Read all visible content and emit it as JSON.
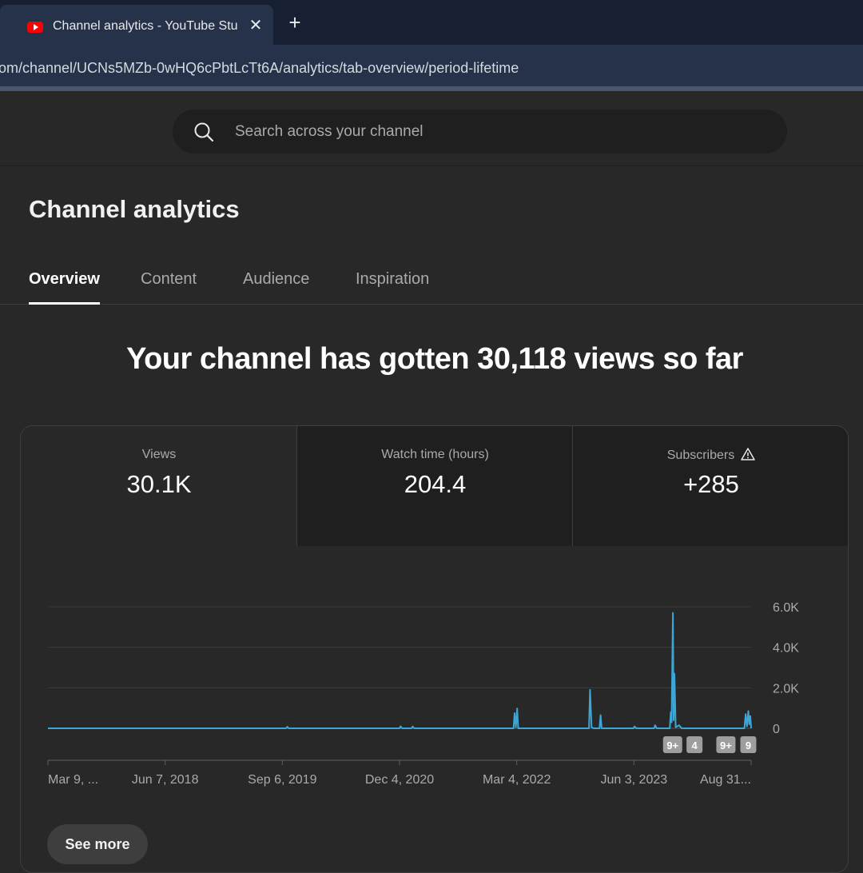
{
  "browser": {
    "tab_title": "Channel analytics - YouTube Studio",
    "close_glyph": "✕",
    "new_tab_glyph": "+",
    "url": "om/channel/UCNs5MZb-0wHQ6cPbtLcTt6A/analytics/tab-overview/period-lifetime"
  },
  "header": {
    "search_placeholder": "Search across your channel"
  },
  "page": {
    "title": "Channel analytics",
    "tabs": [
      {
        "label": "Overview",
        "active": true
      },
      {
        "label": "Content",
        "active": false
      },
      {
        "label": "Audience",
        "active": false
      },
      {
        "label": "Inspiration",
        "active": false
      }
    ],
    "headline": "Your channel has gotten 30,118 views so far"
  },
  "metrics": [
    {
      "label": "Views",
      "value": "30.1K",
      "selected": true
    },
    {
      "label": "Watch time (hours)",
      "value": "204.4",
      "selected": false
    },
    {
      "label": "Subscribers",
      "value": "+285",
      "selected": false,
      "icon": "warning-icon"
    }
  ],
  "see_more_label": "See more",
  "chart_data": {
    "type": "line",
    "color": "#3ea6d6",
    "y_ticks": [
      "6.0K",
      "4.0K",
      "2.0K",
      "0"
    ],
    "ylim": [
      0,
      6000
    ],
    "x_ticks": [
      "Mar 9, ...",
      "Jun 7, 2018",
      "Sep 6, 2019",
      "Dec 4, 2020",
      "Mar 4, 2022",
      "Jun 3, 2023",
      "Aug 31..."
    ],
    "x_range": [
      "2017-03-09",
      "2024-08-31"
    ],
    "points": [
      [
        "2017-03-09",
        0
      ],
      [
        "2019-09-20",
        0
      ],
      [
        "2019-09-25",
        80
      ],
      [
        "2019-09-30",
        0
      ],
      [
        "2020-12-04",
        0
      ],
      [
        "2020-12-08",
        100
      ],
      [
        "2020-12-14",
        0
      ],
      [
        "2021-01-20",
        0
      ],
      [
        "2021-01-24",
        90
      ],
      [
        "2021-01-30",
        0
      ],
      [
        "2022-02-20",
        0
      ],
      [
        "2022-02-24",
        750
      ],
      [
        "2022-03-01",
        50
      ],
      [
        "2022-03-06",
        980
      ],
      [
        "2022-03-10",
        0
      ],
      [
        "2022-12-10",
        0
      ],
      [
        "2022-12-14",
        1900
      ],
      [
        "2022-12-20",
        50
      ],
      [
        "2022-12-28",
        0
      ],
      [
        "2023-01-20",
        0
      ],
      [
        "2023-01-24",
        650
      ],
      [
        "2023-01-28",
        0
      ],
      [
        "2023-06-01",
        0
      ],
      [
        "2023-06-05",
        90
      ],
      [
        "2023-06-12",
        0
      ],
      [
        "2023-08-20",
        0
      ],
      [
        "2023-08-24",
        150
      ],
      [
        "2023-08-30",
        0
      ],
      [
        "2023-10-20",
        0
      ],
      [
        "2023-10-24",
        800
      ],
      [
        "2023-10-27",
        300
      ],
      [
        "2023-11-01",
        5700
      ],
      [
        "2023-11-04",
        400
      ],
      [
        "2023-11-07",
        2700
      ],
      [
        "2023-11-12",
        50
      ],
      [
        "2023-11-25",
        150
      ],
      [
        "2023-12-05",
        0
      ],
      [
        "2024-08-05",
        0
      ],
      [
        "2024-08-10",
        700
      ],
      [
        "2024-08-15",
        100
      ],
      [
        "2024-08-20",
        850
      ],
      [
        "2024-08-24",
        200
      ],
      [
        "2024-08-28",
        600
      ],
      [
        "2024-08-31",
        0
      ]
    ],
    "annotations": [
      {
        "label": "9+",
        "date": "2023-10-31"
      },
      {
        "label": "4",
        "date": "2024-01-24"
      },
      {
        "label": "9+",
        "date": "2024-05-25"
      },
      {
        "label": "9",
        "date": "2024-08-20"
      }
    ]
  }
}
